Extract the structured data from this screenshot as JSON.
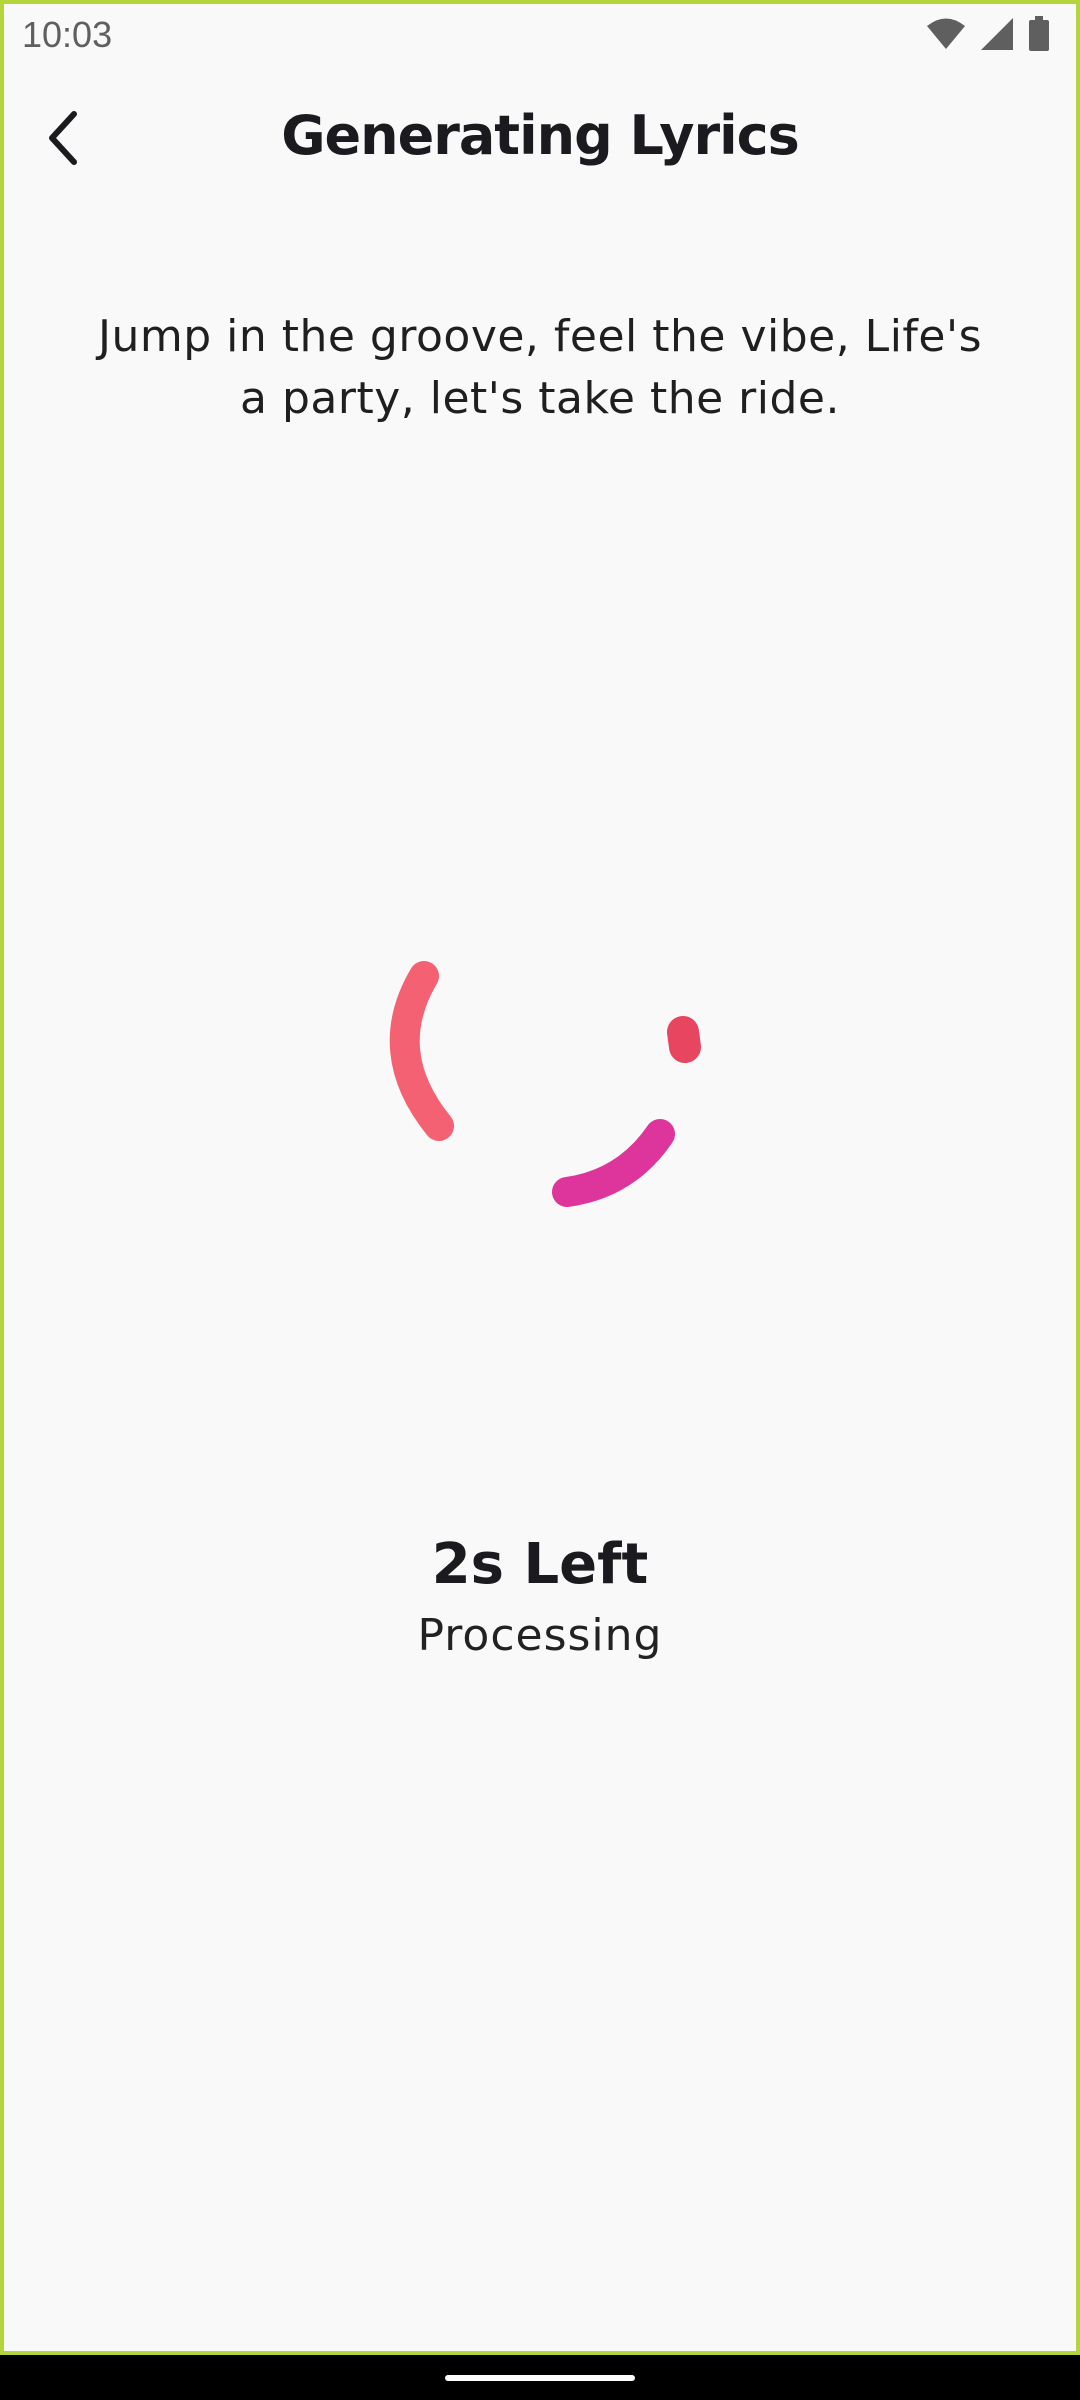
{
  "status_bar": {
    "time": "10:03",
    "icons": [
      "wifi-icon",
      "signal-icon",
      "battery-icon"
    ]
  },
  "header": {
    "back_icon": "chevron-left-icon",
    "title": "Generating Lyrics"
  },
  "main": {
    "lyrics_preview": "Jump in the groove, feel the vibe, Life's a party, let's take the ride.",
    "time_left": "2s Left",
    "status": "Processing"
  },
  "colors": {
    "background": "#f9f9f9",
    "frame_border": "#b5d63a",
    "spinner_coral": "#f46173",
    "spinner_red": "#e84560",
    "spinner_magenta": "#dd359c",
    "nav_bar": "#000000"
  }
}
